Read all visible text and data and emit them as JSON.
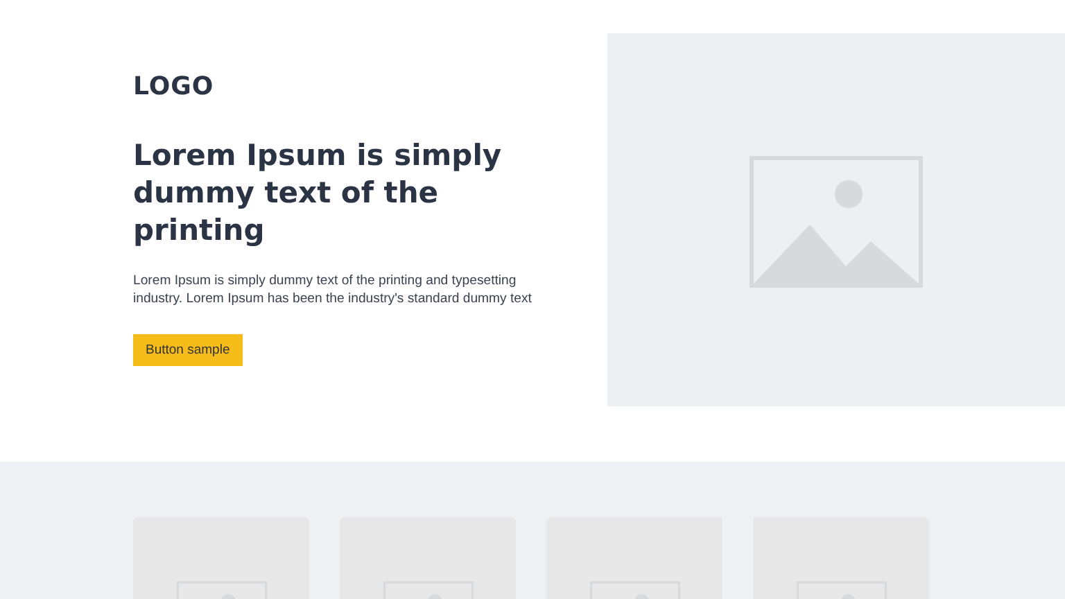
{
  "logo": "LOGO",
  "headline": "Lorem Ipsum is simply dummy text of the printing",
  "body": "Lorem Ipsum is simply dummy text of the printing and typesetting industry. Lorem Ipsum has been the industry's standard dummy text",
  "button": "Button sample",
  "hero_image": {
    "kind": "image-placeholder"
  },
  "cards": [
    {
      "kind": "image-placeholder"
    },
    {
      "kind": "image-placeholder"
    },
    {
      "kind": "image-placeholder"
    },
    {
      "kind": "image-placeholder"
    }
  ]
}
